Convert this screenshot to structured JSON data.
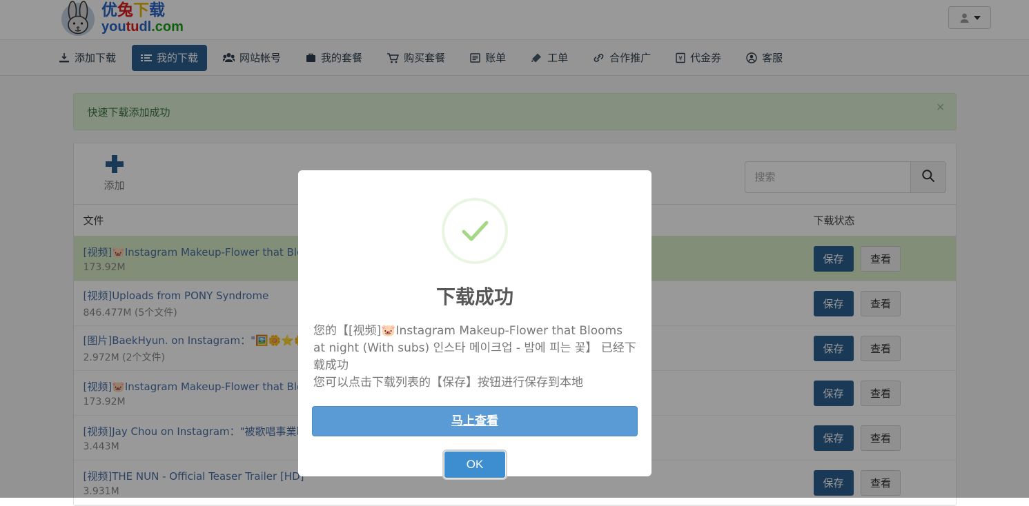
{
  "header": {
    "logo_cn": [
      "优",
      "兔",
      "下",
      "载"
    ],
    "logo_en_parts": [
      "you",
      "tu",
      "dl",
      ".com"
    ],
    "logo_alt": "youtudl.com",
    "user_menu_label": ""
  },
  "nav": {
    "items": [
      {
        "label": "添加下载",
        "icon": "download-icon",
        "active": false
      },
      {
        "label": "我的下载",
        "icon": "list-icon",
        "active": true
      },
      {
        "label": "网站帐号",
        "icon": "users-icon",
        "active": false
      },
      {
        "label": "我的套餐",
        "icon": "briefcase-icon",
        "active": false
      },
      {
        "label": "购买套餐",
        "icon": "cart-icon",
        "active": false
      },
      {
        "label": "账单",
        "icon": "bill-icon",
        "active": false
      },
      {
        "label": "工单",
        "icon": "ticket-icon",
        "active": false
      },
      {
        "label": "合作推广",
        "icon": "link-icon",
        "active": false
      },
      {
        "label": "代金券",
        "icon": "voucher-icon",
        "active": false
      },
      {
        "label": "客服",
        "icon": "support-icon",
        "active": false
      }
    ]
  },
  "alert": {
    "message": "快速下载添加成功",
    "close_label": "×"
  },
  "toolbar": {
    "add_label": "添加",
    "search_placeholder": "搜索",
    "search_value": "",
    "search_icon": "search-icon"
  },
  "table": {
    "columns": [
      "文件",
      "下载状态"
    ],
    "save_label": "保存",
    "view_label": "查看",
    "rows": [
      {
        "name": "[视频]🐷Instagram Makeup-Flower that Blooms at night (With subs) 인스타 메이크업 - 밤에 피는 꽃",
        "size": "173.92M",
        "highlight": true
      },
      {
        "name": "[视频]Uploads from PONY Syndrome",
        "size": "846.477M (5个文件)",
        "highlight": false
      },
      {
        "name": "[图片]BaekHyun. on Instagram：\"🖼️🌼⭐🌼🖼️#최고힐링 #화보촬영",
        "size": "2.972M (2个文件)",
        "highlight": false
      },
      {
        "name": "[视频]🐷Instagram Makeup-Flower that Blooms at night (With subs) 인스타 메이크업 - 밤에 피는 꽃",
        "size": "173.92M",
        "highlight": false
      },
      {
        "name": "[视频]Jay Chou on Instagram：\"被歌唱事業耽誤的魔術師?? @",
        "size": "3.443M",
        "highlight": false
      },
      {
        "name": "[视频]THE NUN - Official Teaser Trailer [HD]",
        "size": "3.931M",
        "highlight": false
      }
    ]
  },
  "modal": {
    "icon": "success-check-icon",
    "title": "下载成功",
    "body_line1": "您的【[视频]🐷Instagram Makeup-Flower that Blooms at night (With subs) 인스타 메이크업 - 밤에 피는 꽃】 已经下载成功",
    "body_line2": "您可以点击下载列表的【保存】按钮进行保存到本地",
    "primary_button": "马上查看",
    "ok_button": "OK"
  },
  "colors": {
    "brand_blue": "#2c5f92",
    "success_green": "#a5d785",
    "alert_bg": "#dff0d8",
    "alert_text": "#3c763d",
    "row_highlight": "#d9edc9",
    "modal_primary": "#5b9bd5",
    "ok_button": "#3d8ed1"
  }
}
